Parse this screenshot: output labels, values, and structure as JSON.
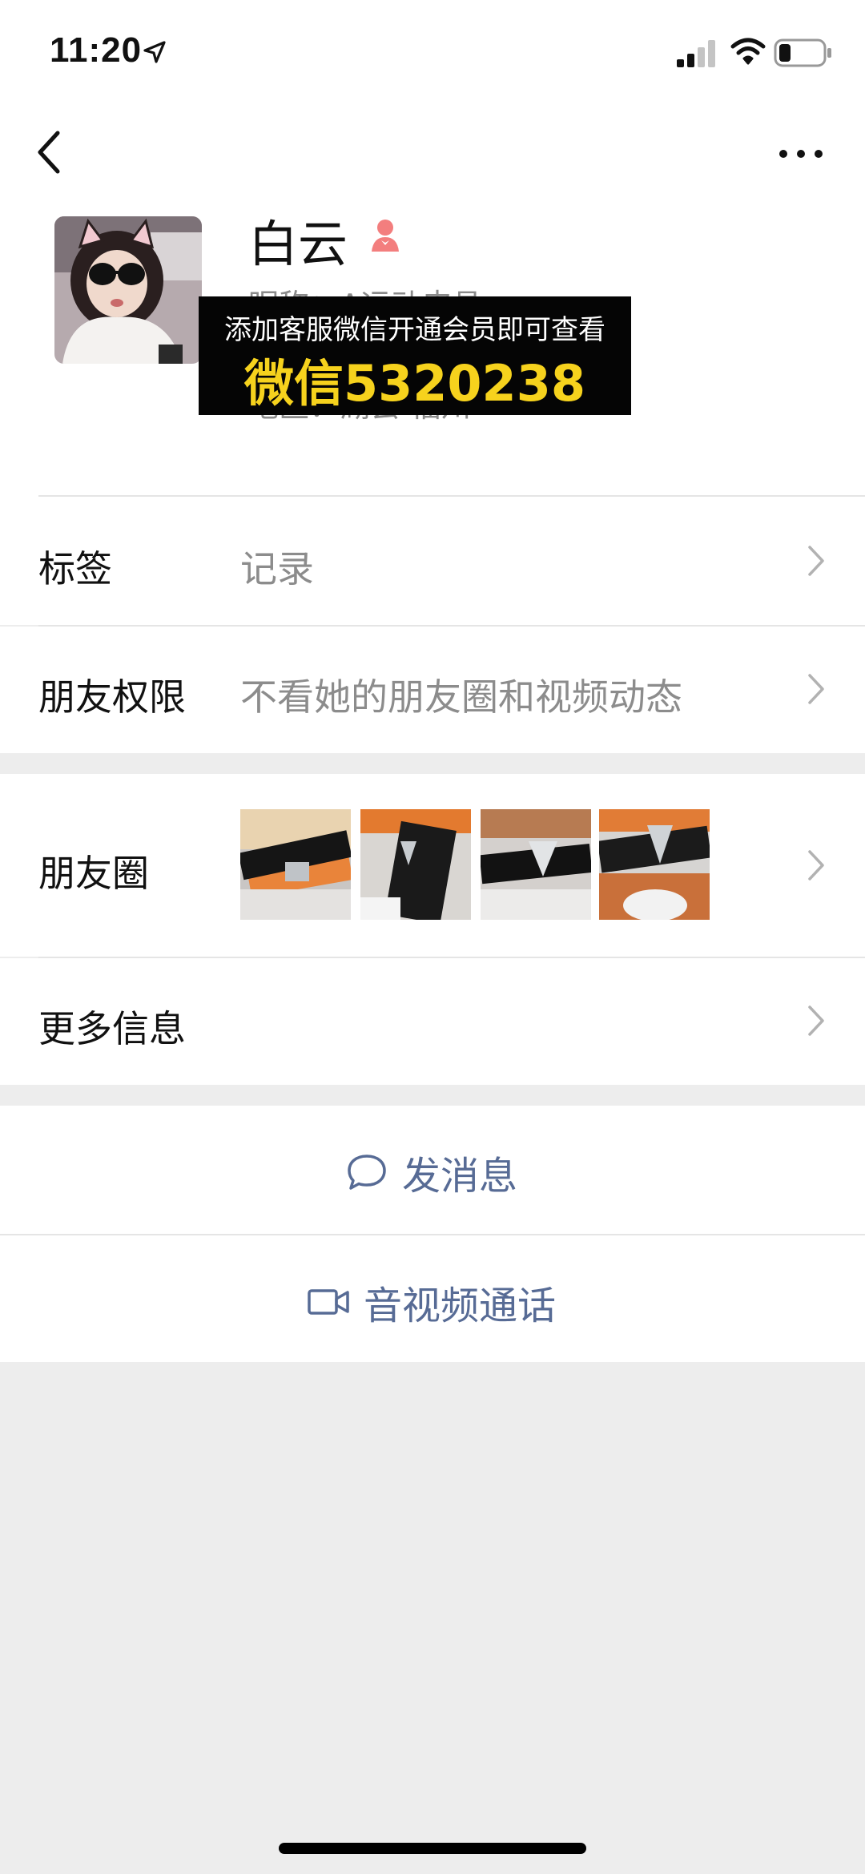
{
  "status_bar": {
    "time": "11:20",
    "icons": [
      "location-arrow-icon",
      "signal-icon",
      "wifi-icon",
      "battery-icon"
    ]
  },
  "nav": {
    "back_icon": "chevron-left-icon",
    "more_icon": "ellipsis-icon"
  },
  "profile": {
    "name": "白云",
    "gender_icon": "female-icon",
    "nickname": "昵称：A运动皮具",
    "region": "地区：湖会 福州"
  },
  "promo_overlay": {
    "line1": "添加客服微信开通会员即可查看",
    "line2": "微信5320238"
  },
  "rows": {
    "tags": {
      "label": "标签",
      "value": "记录"
    },
    "friend_permissions": {
      "label": "朋友权限",
      "value": "不看她的朋友圈和视频动态"
    },
    "moments": {
      "label": "朋友圈"
    },
    "more_info": {
      "label": "更多信息"
    }
  },
  "actions": {
    "send_message": {
      "label": "发消息",
      "icon": "chat-bubble-icon"
    },
    "video_call": {
      "label": "音视频通话",
      "icon": "video-camera-icon"
    }
  },
  "colors": {
    "link_blue": "#576b95",
    "promo_yellow": "#f6d21d",
    "female_pink": "#f37e7e"
  }
}
